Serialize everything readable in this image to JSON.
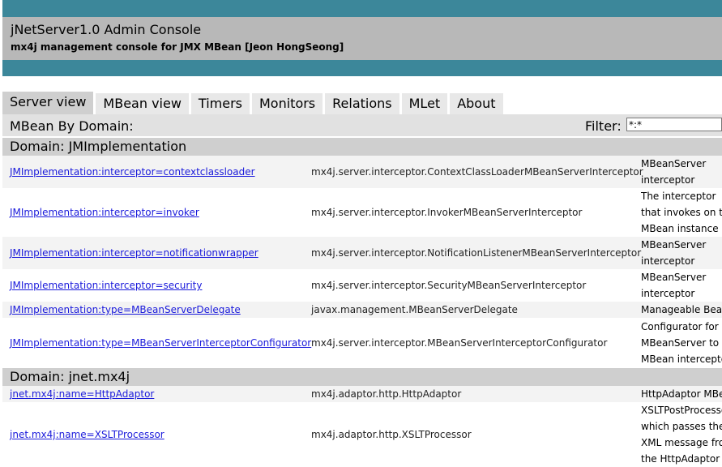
{
  "header": {
    "title": "jNetServer1.0 Admin Console",
    "subtitle": "mx4j management console for JMX MBean [Jeon HongSeong]"
  },
  "tabs": [
    "Server view",
    "MBean view",
    "Timers",
    "Monitors",
    "Relations",
    "MLet",
    "About"
  ],
  "filter": {
    "section_label": "MBean By Domain:",
    "filter_label": "Filter:",
    "value": "*:*"
  },
  "domains": [
    {
      "label": "Domain: JMImplementation",
      "rows": [
        {
          "name": "JMImplementation:interceptor=contextclassloader",
          "class": "mx4j.server.interceptor.ContextClassLoaderMBeanServerInterceptor",
          "desc": [
            "MBeanServer",
            "interceptor"
          ]
        },
        {
          "name": "JMImplementation:interceptor=invoker",
          "class": "mx4j.server.interceptor.InvokerMBeanServerInterceptor",
          "desc": [
            "The interceptor",
            "that invokes on the",
            "MBean instance"
          ]
        },
        {
          "name": "JMImplementation:interceptor=notificationwrapper",
          "class": "mx4j.server.interceptor.NotificationListenerMBeanServerInterceptor",
          "desc": [
            "MBeanServer",
            "interceptor"
          ]
        },
        {
          "name": "JMImplementation:interceptor=security",
          "class": "mx4j.server.interceptor.SecurityMBeanServerInterceptor",
          "desc": [
            "MBeanServer",
            "interceptor"
          ]
        },
        {
          "name": "JMImplementation:type=MBeanServerDelegate",
          "class": "javax.management.MBeanServerDelegate",
          "desc": [
            "Manageable Bean"
          ]
        },
        {
          "name": "JMImplementation:type=MBeanServerInterceptorConfigurator",
          "class": "mx4j.server.interceptor.MBeanServerInterceptorConfigurator",
          "desc": [
            "Configurator for",
            "MBeanServer to",
            "MBean interceptor"
          ]
        }
      ]
    },
    {
      "label": "Domain: jnet.mx4j",
      "rows": [
        {
          "name": "jnet.mx4j:name=HttpAdaptor",
          "class": "mx4j.adaptor.http.HttpAdaptor",
          "desc": [
            "HttpAdaptor MBean"
          ]
        },
        {
          "name": "jnet.mx4j:name=XSLTProcessor",
          "class": "mx4j.adaptor.http.XSLTProcessor",
          "desc": [
            "XSLTPostProcessor",
            "which passes the",
            "XML message from",
            "the HttpAdaptor"
          ]
        }
      ]
    }
  ]
}
